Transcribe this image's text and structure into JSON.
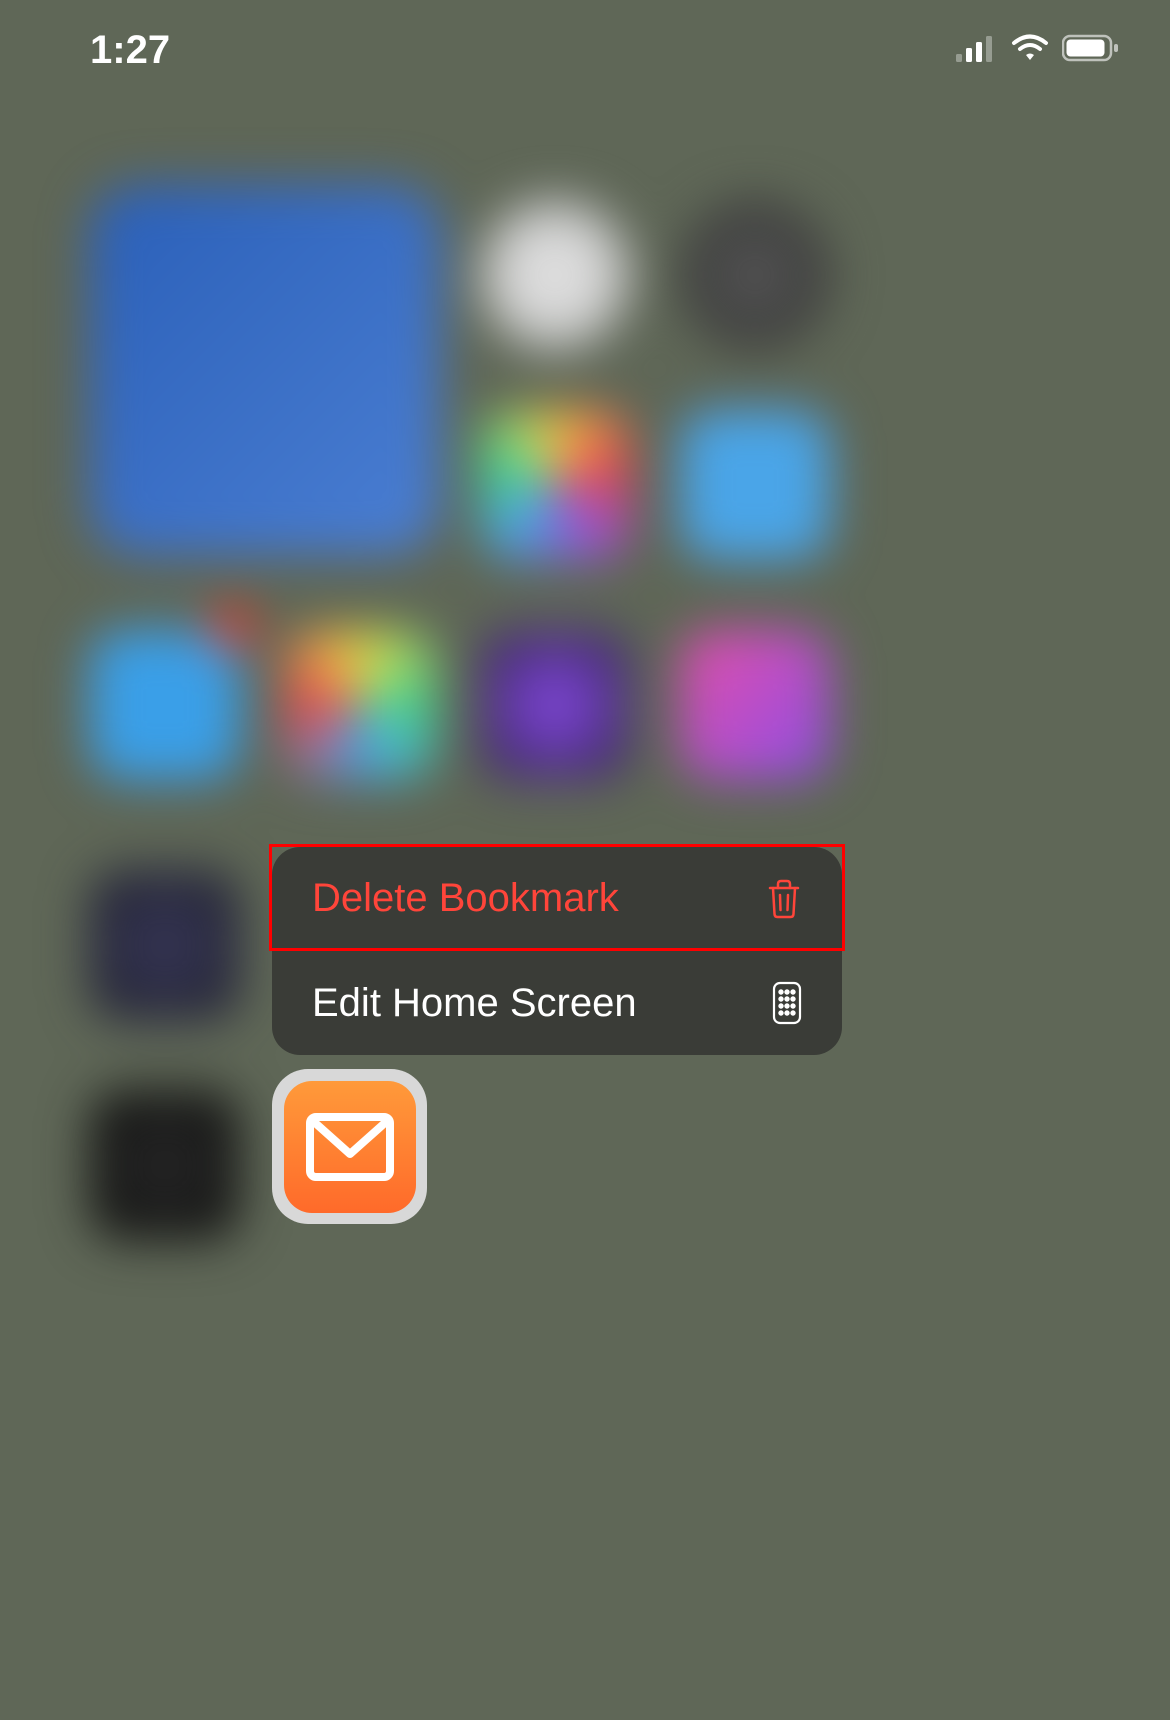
{
  "statusBar": {
    "time": "1:27"
  },
  "contextMenu": {
    "items": [
      {
        "label": "Delete Bookmark",
        "destructive": true
      },
      {
        "label": "Edit Home Screen",
        "destructive": false
      }
    ]
  },
  "colors": {
    "destructive": "#ff453a",
    "menuBackground": "#3a3c37",
    "highlight": "#ff0000"
  }
}
